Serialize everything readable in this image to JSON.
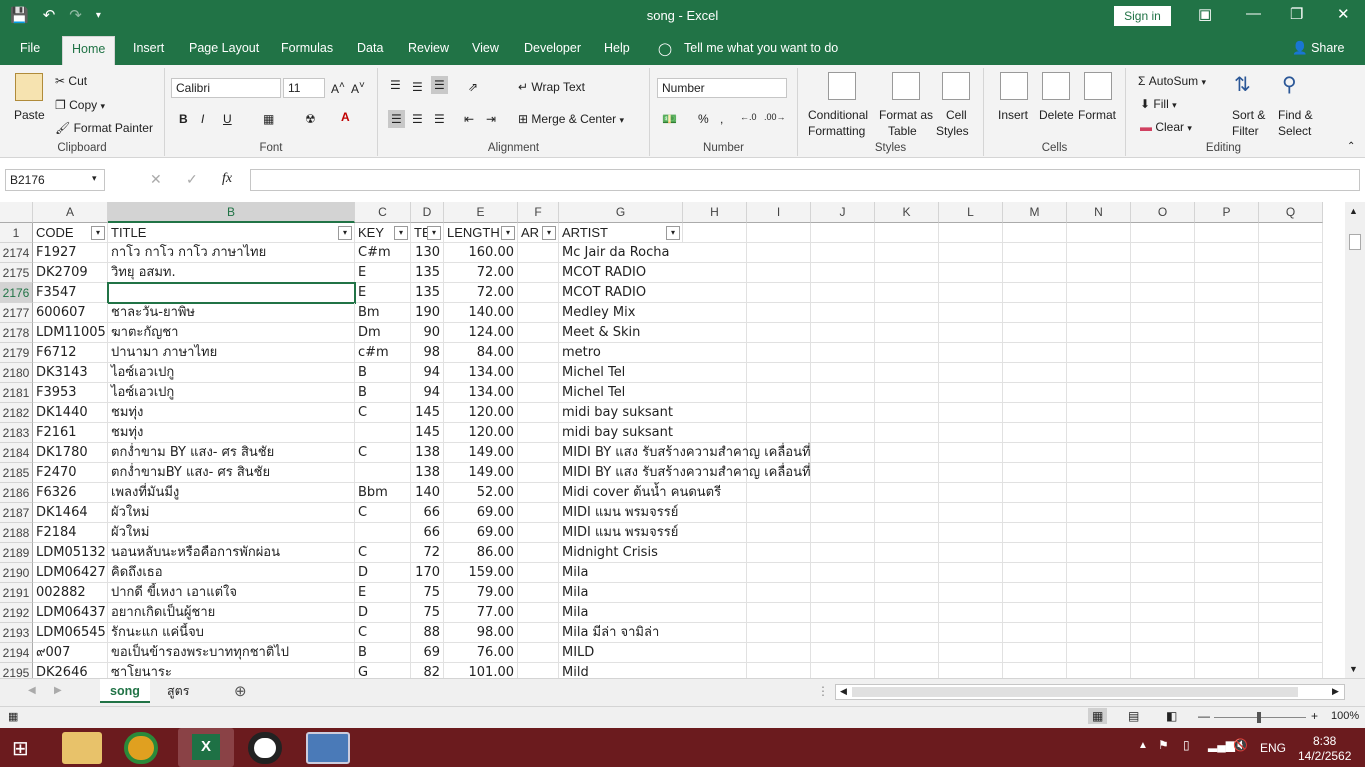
{
  "window": {
    "title": "song  -  Excel",
    "sign_in": "Sign in"
  },
  "ribbon_tabs": [
    "File",
    "Home",
    "Insert",
    "Page Layout",
    "Formulas",
    "Data",
    "Review",
    "View",
    "Developer",
    "Help"
  ],
  "tell_me": "Tell me what you want to do",
  "share": "Share",
  "clipboard": {
    "paste": "Paste",
    "cut": "Cut",
    "copy": "Copy",
    "format_painter": "Format Painter",
    "label": "Clipboard"
  },
  "font": {
    "name": "Calibri",
    "size": "11",
    "label": "Font",
    "bold": "B",
    "italic": "I",
    "underline": "U"
  },
  "alignment": {
    "wrap": "Wrap Text",
    "merge": "Merge & Center",
    "label": "Alignment"
  },
  "number": {
    "format": "Number",
    "label": "Number",
    "percent": "%",
    "comma": ","
  },
  "styles": {
    "conditional": "Conditional",
    "conditional2": "Formatting",
    "format_as": "Format as",
    "format_as2": "Table",
    "cell": "Cell",
    "cell2": "Styles",
    "label": "Styles"
  },
  "cells": {
    "insert": "Insert",
    "delete": "Delete",
    "format": "Format",
    "label": "Cells"
  },
  "editing": {
    "autosum": "AutoSum",
    "fill": "Fill",
    "clear": "Clear",
    "sort": "Sort &",
    "sort2": "Filter",
    "find": "Find &",
    "find2": "Select",
    "label": "Editing"
  },
  "formula_bar": {
    "name_box": "B2176",
    "fx": "fx",
    "value": ""
  },
  "columns": [
    "A",
    "B",
    "C",
    "D",
    "E",
    "F",
    "G",
    "H",
    "I",
    "J",
    "K",
    "L",
    "M",
    "N",
    "O",
    "P",
    "Q"
  ],
  "header_row": {
    "num": "1",
    "cells": [
      "CODE",
      "TITLE",
      "KEY",
      "TE",
      "LENGTH",
      "AR",
      "ARTIST"
    ]
  },
  "rows": [
    {
      "n": "2174",
      "a": "F1927",
      "b": "กาโว กาโว กาโว ภาษาไทย",
      "c": "C#m",
      "d": "130",
      "e": "160.00",
      "g": "Mc Jair da Rocha"
    },
    {
      "n": "2175",
      "a": "DK2709",
      "b": "วิทยุ อสมท.",
      "c": "E",
      "d": "135",
      "e": "72.00",
      "g": "MCOT RADIO"
    },
    {
      "n": "2176",
      "a": "F3547",
      "b": "",
      "c": "E",
      "d": "135",
      "e": "72.00",
      "g": "MCOT RADIO"
    },
    {
      "n": "2177",
      "a": "600607",
      "b": "ชาละวัน-ยาพิษ",
      "c": "Bm",
      "d": "190",
      "e": "140.00",
      "g": "Medley Mix"
    },
    {
      "n": "2178",
      "a": "LDM11005",
      "b": "ฆาตะกัญชา",
      "c": "Dm",
      "d": "90",
      "e": "124.00",
      "g": "Meet & Skin"
    },
    {
      "n": "2179",
      "a": "F6712",
      "b": "ปานามา ภาษาไทย",
      "c": "c#m",
      "d": "98",
      "e": "84.00",
      "g": "metro"
    },
    {
      "n": "2180",
      "a": "DK3143",
      "b": "ไอซ์เอวเปกู",
      "c": "B",
      "d": "94",
      "e": "134.00",
      "g": "Michel Tel"
    },
    {
      "n": "2181",
      "a": "F3953",
      "b": "ไอซ์เอวเปกู",
      "c": "B",
      "d": "94",
      "e": "134.00",
      "g": "Michel Tel"
    },
    {
      "n": "2182",
      "a": "DK1440",
      "b": "ชมทุ่ง",
      "c": "C",
      "d": "145",
      "e": "120.00",
      "g": "midi bay suksant"
    },
    {
      "n": "2183",
      "a": "F2161",
      "b": "ชมทุ่ง",
      "c": "",
      "d": "145",
      "e": "120.00",
      "g": "midi bay suksant"
    },
    {
      "n": "2184",
      "a": "DK1780",
      "b": "ตกง่ำขาม  BY แสง- ศร สินชัย",
      "c": "C",
      "d": "138",
      "e": "149.00",
      "g": "MIDI BY  แสง  รับสร้างความสำคาญ เคลื่อนที่"
    },
    {
      "n": "2185",
      "a": "F2470",
      "b": "ตกง่ำขามBY แสง- ศร สินชัย",
      "c": "",
      "d": "138",
      "e": "149.00",
      "g": "MIDI BY  แสง  รับสร้างความสำคาญ เคลื่อนที่"
    },
    {
      "n": "2186",
      "a": "F6326",
      "b": "เพลงที่มันมีงู",
      "c": "Bbm",
      "d": "140",
      "e": "52.00",
      "g": "Midi cover ต้นน้ำ คนดนตรี"
    },
    {
      "n": "2187",
      "a": "DK1464",
      "b": "ผัวใหม่",
      "c": "C",
      "d": "66",
      "e": "69.00",
      "g": "MIDI แมน พรมจรรย์"
    },
    {
      "n": "2188",
      "a": "F2184",
      "b": "ผัวใหม่",
      "c": "",
      "d": "66",
      "e": "69.00",
      "g": "MIDI แมน พรมจรรย์"
    },
    {
      "n": "2189",
      "a": "LDM05132",
      "b": "นอนหลับนะหรือคือการพักผ่อน",
      "c": "C",
      "d": "72",
      "e": "86.00",
      "g": "Midnight Crisis"
    },
    {
      "n": "2190",
      "a": "LDM06427",
      "b": "คิดถึงเธอ",
      "c": "D",
      "d": "170",
      "e": "159.00",
      "g": "Mila"
    },
    {
      "n": "2191",
      "a": "002882",
      "b": "ปากดี ขี้เหงา เอาแต่ใจ",
      "c": "E",
      "d": "75",
      "e": "79.00",
      "g": "Mila"
    },
    {
      "n": "2192",
      "a": "LDM06437",
      "b": "อยากเกิดเป็นผู้ชาย",
      "c": "D",
      "d": "75",
      "e": "77.00",
      "g": "Mila"
    },
    {
      "n": "2193",
      "a": "LDM06545",
      "b": "รักนะแก แค่นี้จบ",
      "c": "C",
      "d": "88",
      "e": "98.00",
      "g": "Mila มีล่า จามิล่า"
    },
    {
      "n": "2194",
      "a": "๙007",
      "b": "ขอเป็นข้ารองพระบาททุกชาติไป",
      "c": "B",
      "d": "69",
      "e": "76.00",
      "g": "MILD"
    },
    {
      "n": "2195",
      "a": "DK2646",
      "b": "ซาโยนาระ",
      "c": "G",
      "d": "82",
      "e": "101.00",
      "g": "Mild"
    }
  ],
  "sheets": [
    "song",
    "สูตร"
  ],
  "zoom": "100%",
  "clock": {
    "time": "8:38",
    "date": "14/2/2562"
  },
  "lang": "ENG"
}
